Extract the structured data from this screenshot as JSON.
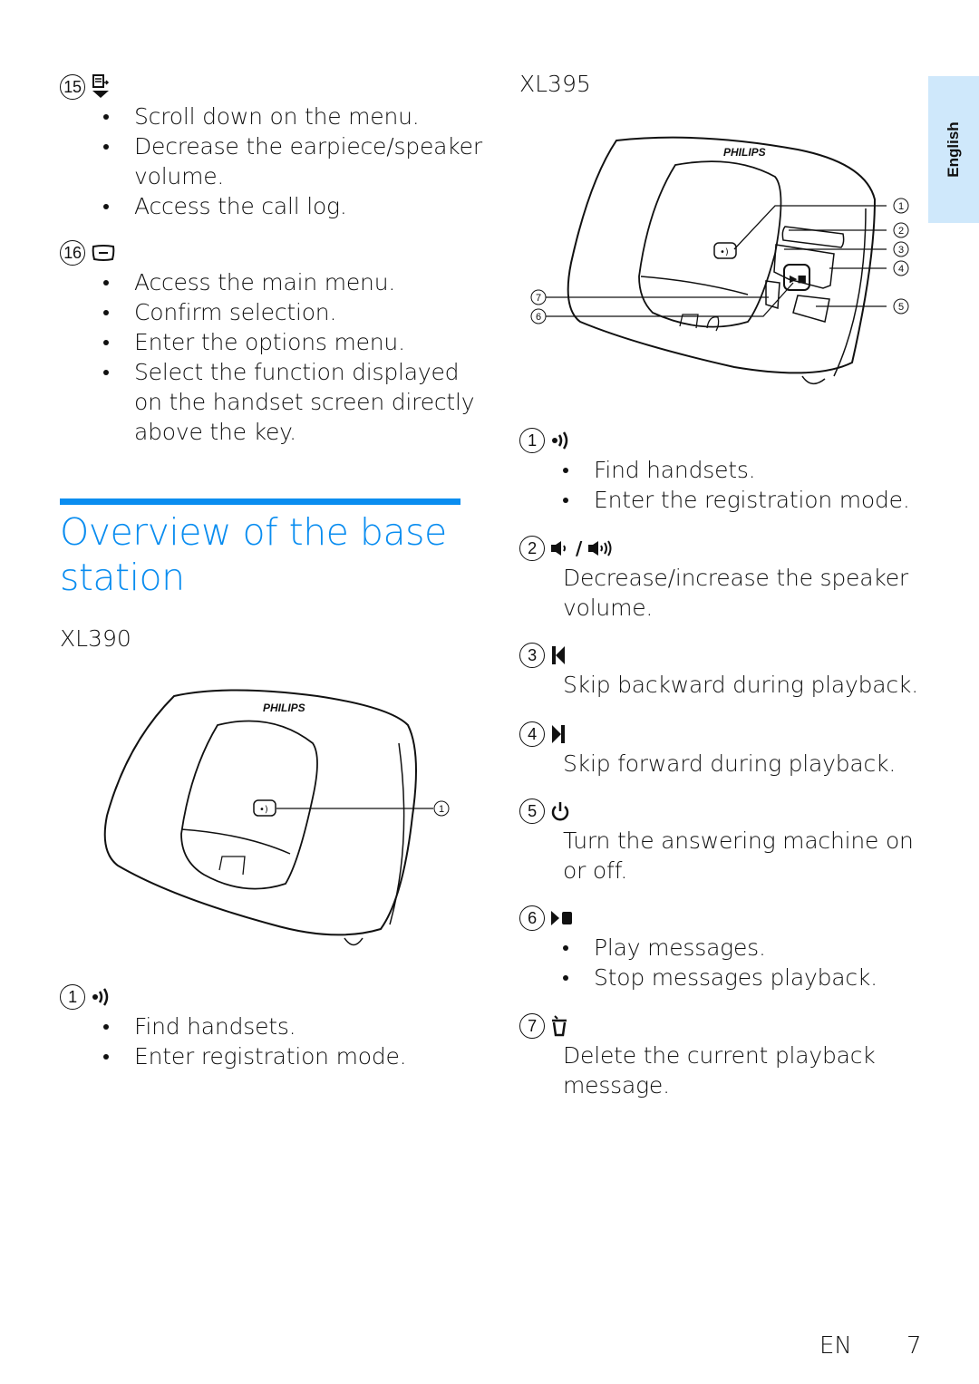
{
  "sidebar_tab": {
    "label": "English"
  },
  "left_column": {
    "item15": {
      "number": "15",
      "icon": "scroll-down-call-log-icon",
      "bullets": [
        "Scroll down on the menu.",
        "Decrease the earpiece/speaker",
        "volume.",
        "Access the call log."
      ]
    },
    "item16": {
      "number": "16",
      "icon": "menu-key-icon",
      "bullets": [
        "Access the main menu.",
        "Confirm selection.",
        "Enter the options menu.",
        "Select the function displayed",
        "on the handset screen directly",
        "above the key."
      ]
    },
    "section": {
      "title_line1": "Overview of the base",
      "title_line2": "station",
      "accent_color": "#0a8df0"
    },
    "xl390": {
      "model": "XL390",
      "figure": {
        "brand": "PHILIPS",
        "callouts": [
          "1"
        ]
      },
      "item1": {
        "number": "1",
        "icon": "paging-icon",
        "bullets": [
          "Find handsets.",
          "Enter registration mode."
        ]
      }
    }
  },
  "right_column": {
    "xl395": {
      "model": "XL395",
      "figure": {
        "brand": "PHILIPS",
        "callouts": [
          "1",
          "2",
          "3",
          "4",
          "5",
          "7",
          "6"
        ]
      }
    },
    "items": [
      {
        "number": "1",
        "icon": "paging-icon",
        "bullets": [
          "Find handsets.",
          "Enter the registration mode."
        ]
      },
      {
        "number": "2",
        "icon": "volume-icon",
        "separator": "/",
        "text": [
          "Decrease/increase the speaker",
          "volume."
        ]
      },
      {
        "number": "3",
        "icon": "skip-back-icon",
        "text": [
          "Skip backward during playback."
        ]
      },
      {
        "number": "4",
        "icon": "skip-forward-icon",
        "text": [
          "Skip forward during playback."
        ]
      },
      {
        "number": "5",
        "icon": "power-icon",
        "text": [
          "Turn the answering machine on",
          "or off."
        ]
      },
      {
        "number": "6",
        "icon": "play-stop-icon",
        "bullets": [
          "Play messages.",
          "Stop messages playback."
        ]
      },
      {
        "number": "7",
        "icon": "delete-icon",
        "text": [
          "Delete the current playback",
          "message."
        ]
      }
    ]
  },
  "footer": {
    "lang": "EN",
    "page": "7"
  }
}
